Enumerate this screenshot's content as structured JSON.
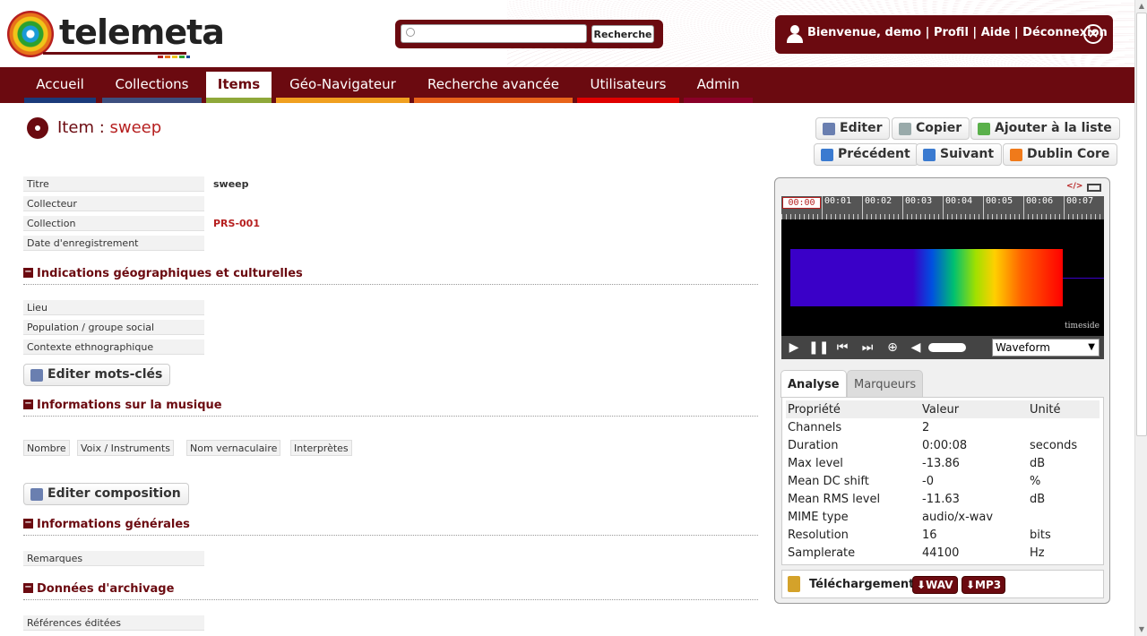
{
  "header": {
    "logo_text": "telemeta",
    "search": {
      "placeholder": "",
      "button": "Recherche"
    },
    "user": {
      "welcome": "Bienvenue, demo",
      "profile": "Profil",
      "help": "Aide",
      "logout": "Déconnexion",
      "sep": " | "
    }
  },
  "nav": {
    "items": [
      {
        "label": "Accueil",
        "color": "#1a3a7a"
      },
      {
        "label": "Collections",
        "color": "#3d4f7f"
      },
      {
        "label": "Items",
        "color": "#8fa83a",
        "active": true
      },
      {
        "label": "Géo-Navigateur",
        "color": "#f0a020"
      },
      {
        "label": "Recherche avancée",
        "color": "#e8641a"
      },
      {
        "label": "Utilisateurs",
        "color": "#e00000"
      },
      {
        "label": "Admin",
        "color": "#8a0028"
      }
    ]
  },
  "item": {
    "prefix": "Item : ",
    "name": "sweep"
  },
  "actions": {
    "edit": "Editer",
    "copy": "Copier",
    "add_list": "Ajouter à la liste",
    "previous": "Précédent",
    "next": "Suivant",
    "dublin": "Dublin Core"
  },
  "fields": {
    "title_label": "Titre",
    "title_value": "sweep",
    "collector_label": "Collecteur",
    "collection_label": "Collection",
    "collection_value": "PRS-001",
    "date_label": "Date d'enregistrement"
  },
  "sections": {
    "geo": "Indications géographiques et culturelles",
    "music": "Informations sur la musique",
    "general": "Informations générales",
    "archive": "Données d'archivage"
  },
  "geo_fields": {
    "place": "Lieu",
    "population": "Population / groupe social",
    "context": "Contexte ethnographique"
  },
  "edit_keywords": "Editer mots-clés",
  "music_cols": [
    "Nombre",
    "Voix / Instruments",
    "Nom vernaculaire",
    "Interprètes"
  ],
  "edit_composition": "Editer composition",
  "general_fields": {
    "remarks": "Remarques"
  },
  "archive_fields": {
    "refs": "Références éditées"
  },
  "player": {
    "code_icon": "</>",
    "ruler": [
      "00:00",
      "00:01",
      "00:02",
      "00:03",
      "00:04",
      "00:05",
      "00:06",
      "00:07"
    ],
    "brand": "timeside",
    "view_select": "Waveform",
    "tabs": [
      "Analyse",
      "Marqueurs"
    ],
    "analysis_headers": [
      "Propriété",
      "Valeur",
      "Unité"
    ],
    "analysis_rows": [
      [
        "Channels",
        "2",
        ""
      ],
      [
        "Duration",
        "0:00:08",
        "seconds"
      ],
      [
        "Max level",
        "-13.86",
        "dB"
      ],
      [
        "Mean DC shift",
        "-0",
        "%"
      ],
      [
        "Mean RMS level",
        "-11.63",
        "dB"
      ],
      [
        "MIME type",
        "audio/x-wav",
        ""
      ],
      [
        "Resolution",
        "16",
        "bits"
      ],
      [
        "Samplerate",
        "44100",
        "Hz"
      ]
    ],
    "download_label": "Téléchargement:",
    "download_wav": "⬇WAV",
    "download_mp3": "⬇MP3"
  }
}
